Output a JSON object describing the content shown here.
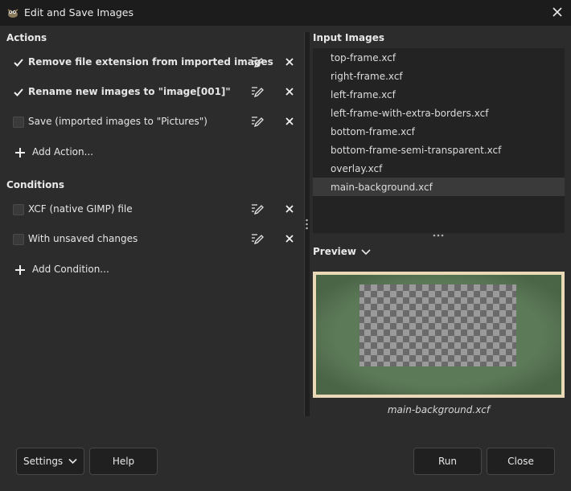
{
  "window": {
    "title": "Edit and Save Images"
  },
  "actions": {
    "heading": "Actions",
    "items": [
      {
        "label": "Remove file extension from imported images",
        "checked": true,
        "bold": true
      },
      {
        "label": "Rename new images to \"image[001]\"",
        "checked": true,
        "bold": true
      },
      {
        "label": "Save (imported images to \"Pictures\")",
        "checked": false,
        "bold": false
      }
    ],
    "add_label": "Add Action..."
  },
  "conditions": {
    "heading": "Conditions",
    "items": [
      {
        "label": "XCF (native GIMP) file",
        "checked": false
      },
      {
        "label": "With unsaved changes",
        "checked": false
      }
    ],
    "add_label": "Add Condition..."
  },
  "input_images": {
    "heading": "Input Images",
    "files": [
      "top-frame.xcf",
      "right-frame.xcf",
      "left-frame.xcf",
      "left-frame-with-extra-borders.xcf",
      "bottom-frame.xcf",
      "bottom-frame-semi-transparent.xcf",
      "overlay.xcf",
      "main-background.xcf"
    ],
    "selected": "main-background.xcf"
  },
  "preview": {
    "heading": "Preview",
    "caption": "main-background.xcf"
  },
  "footer": {
    "settings_label": "Settings",
    "help_label": "Help",
    "run_label": "Run",
    "close_label": "Close"
  }
}
